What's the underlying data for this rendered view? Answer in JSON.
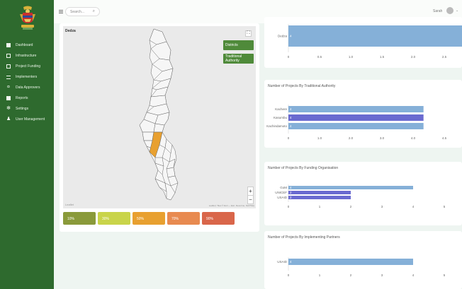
{
  "sidebar": {
    "items": [
      {
        "label": "Dashboard",
        "icon": "dashboard-icon"
      },
      {
        "label": "Infrastructure",
        "icon": "bar-chart-icon"
      },
      {
        "label": "Project Funding",
        "icon": "calendar-icon"
      },
      {
        "label": "Implementers",
        "icon": "list-icon"
      },
      {
        "label": "Data Approvers",
        "icon": "approve-icon"
      },
      {
        "label": "Reports",
        "icon": "report-icon"
      },
      {
        "label": "Settings",
        "icon": "gear-icon"
      },
      {
        "label": "User Management",
        "icon": "user-icon"
      }
    ]
  },
  "topbar": {
    "search_placeholder": "Search...",
    "user_name": "Sarah"
  },
  "map": {
    "label": "Dedza",
    "buttons": [
      "Districts",
      "Traditional Authority"
    ],
    "logo": "Leaflet",
    "attribution": "Leaflet | Tiles © Esri — Esri, DeLorme, NAVTEQ",
    "highlight_color": "#e8a030",
    "legend": [
      {
        "label": "10%",
        "color": "#8a9a3a"
      },
      {
        "label": "30%",
        "color": "#c9d44a"
      },
      {
        "label": "50%",
        "color": "#e8a030"
      },
      {
        "label": "70%",
        "color": "#e88a50"
      },
      {
        "label": "90%",
        "color": "#d9664a"
      }
    ]
  },
  "chart_data": [
    {
      "type": "bar",
      "orientation": "horizontal",
      "title": "",
      "categories": [
        "Dedza"
      ],
      "values": [
        4
      ],
      "data_labels": [
        "4"
      ],
      "xticks": [
        "0",
        "0.5",
        "1.0",
        "1.5",
        "2.0",
        "2.5"
      ],
      "xlim": [
        0,
        2.5
      ],
      "colors": [
        "#85b0d8"
      ]
    },
    {
      "type": "bar",
      "orientation": "horizontal",
      "title": "Number of Projects By Traditional Authority",
      "categories": [
        "Kachere",
        "Kasumbu",
        "Kachindamoto"
      ],
      "values": [
        3.9,
        3.9,
        3.9
      ],
      "data_labels": [
        "4",
        "4",
        "4"
      ],
      "xticks": [
        "0",
        "1.0",
        "2.0",
        "3.0",
        "4.0",
        "4.5"
      ],
      "xlim": [
        0,
        4.5
      ],
      "colors": [
        "#85b0d8",
        "#6a6ad0",
        "#85b0d8"
      ]
    },
    {
      "type": "bar",
      "orientation": "horizontal",
      "title": "Number of Projects By Funding Organisation",
      "categories": [
        "GoM",
        "UNICEF",
        "USAID"
      ],
      "values": [
        4,
        2,
        2
      ],
      "data_labels": [
        "4",
        "2",
        "2"
      ],
      "xticks": [
        "0",
        "1",
        "2",
        "3",
        "4",
        "5"
      ],
      "xlim": [
        0,
        5
      ],
      "colors": [
        "#85b0d8",
        "#6a6ad0",
        "#6a6ad0"
      ]
    },
    {
      "type": "bar",
      "orientation": "horizontal",
      "title": "Number of Projects By Implementing Partners",
      "categories": [
        "USAID"
      ],
      "values": [
        4
      ],
      "data_labels": [
        "4"
      ],
      "xticks": [
        "0",
        "1",
        "2",
        "3",
        "4",
        "5"
      ],
      "xlim": [
        0,
        5
      ],
      "colors": [
        "#85b0d8"
      ]
    }
  ]
}
